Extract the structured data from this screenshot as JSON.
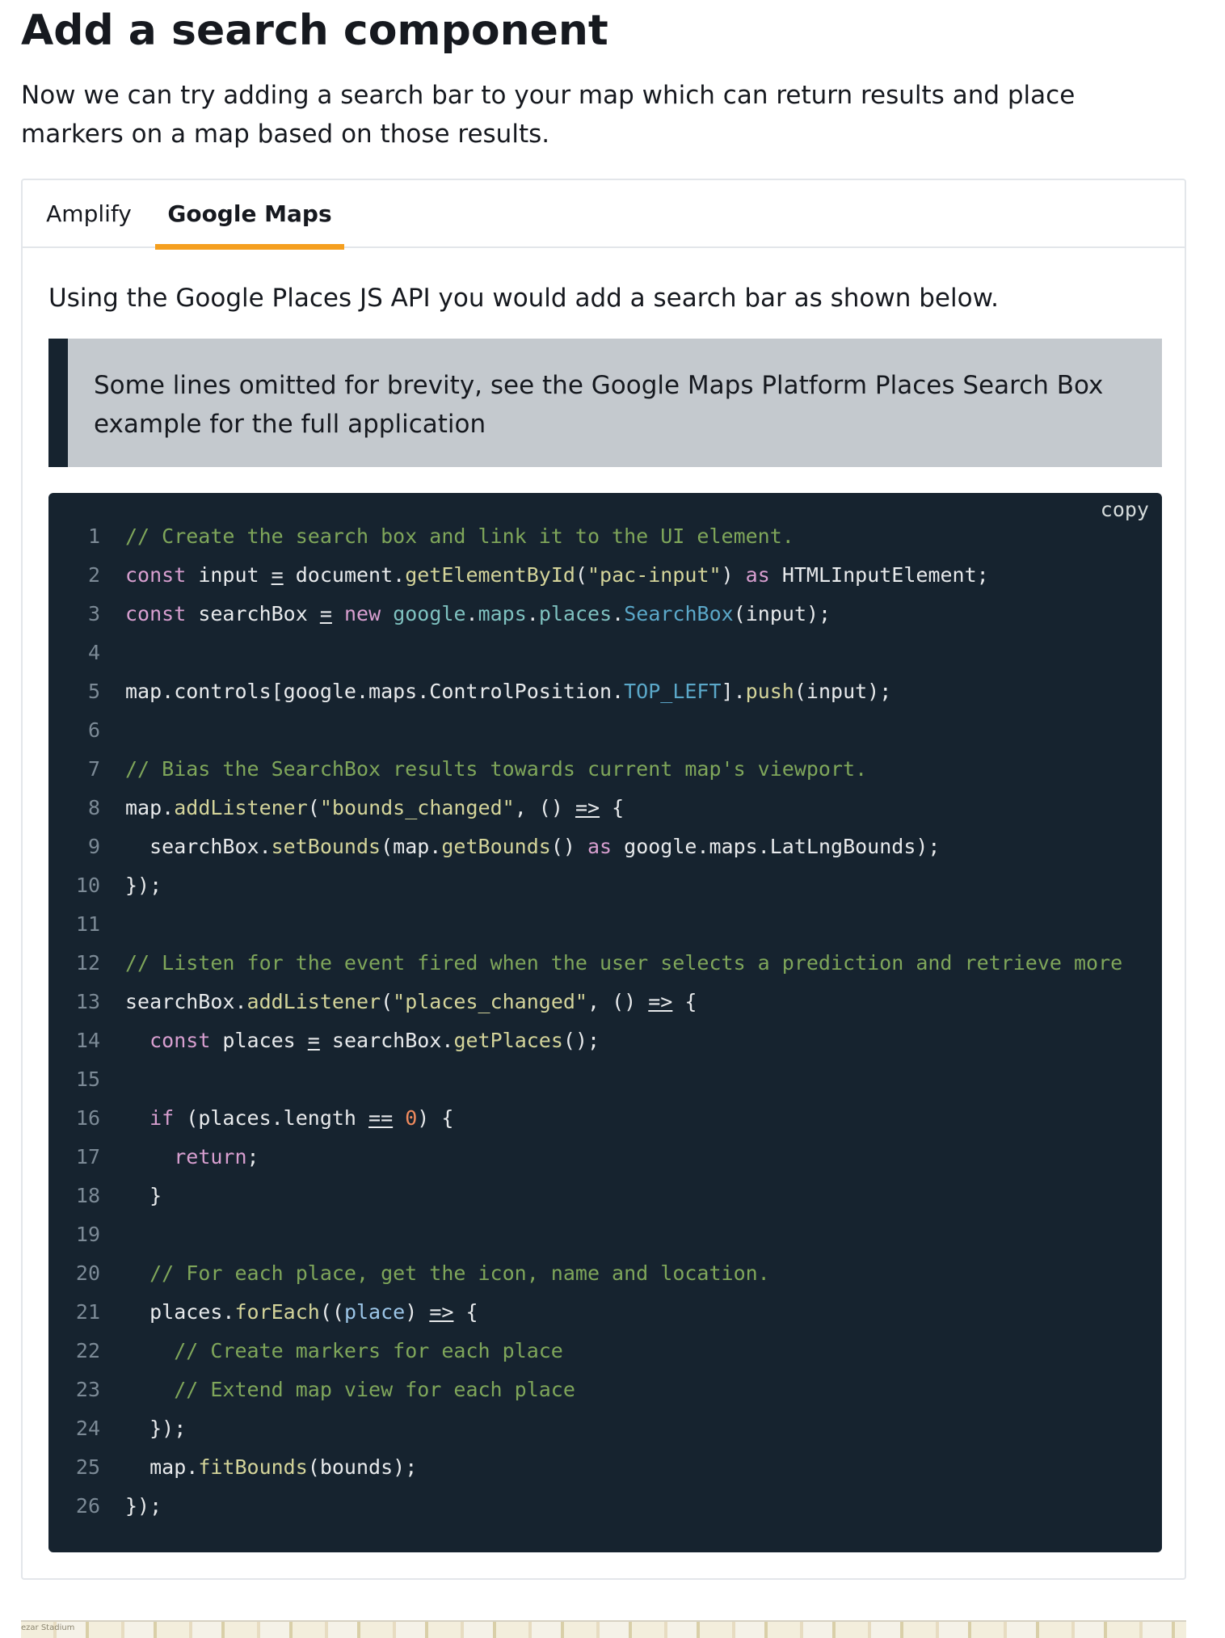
{
  "page": {
    "title": "Add a search component",
    "intro": "Now we can try adding a search bar to your map which can return results and place markers on a map based on those results."
  },
  "tabs": [
    {
      "label": "Amplify",
      "active": false
    },
    {
      "label": "Google Maps",
      "active": true
    }
  ],
  "panel": {
    "text": "Using the Google Places JS API you would add a search bar as shown below.",
    "callout": "Some lines omitted for brevity, see the Google Maps Platform Places Search Box example for the full application"
  },
  "code": {
    "copy_label": "copy",
    "lines": [
      {
        "n": "1",
        "tokens": [
          [
            "comment",
            "// Create the search box and link it to the UI element."
          ]
        ]
      },
      {
        "n": "2",
        "tokens": [
          [
            "keyword",
            "const"
          ],
          [
            "plain",
            " input "
          ],
          [
            "op",
            "="
          ],
          [
            "plain",
            " document."
          ],
          [
            "function",
            "getElementById"
          ],
          [
            "plain",
            "("
          ],
          [
            "string",
            "\"pac-input\""
          ],
          [
            "plain",
            ") "
          ],
          [
            "keyword",
            "as"
          ],
          [
            "plain",
            " HTMLInputElement;"
          ]
        ]
      },
      {
        "n": "3",
        "tokens": [
          [
            "keyword",
            "const"
          ],
          [
            "plain",
            " searchBox "
          ],
          [
            "op",
            "="
          ],
          [
            "plain",
            " "
          ],
          [
            "keyword",
            "new"
          ],
          [
            "plain",
            " "
          ],
          [
            "property",
            "google"
          ],
          [
            "plain",
            "."
          ],
          [
            "property",
            "maps"
          ],
          [
            "plain",
            "."
          ],
          [
            "property",
            "places"
          ],
          [
            "plain",
            "."
          ],
          [
            "class",
            "SearchBox"
          ],
          [
            "plain",
            "(input);"
          ]
        ]
      },
      {
        "n": "4",
        "tokens": []
      },
      {
        "n": "5",
        "tokens": [
          [
            "plain",
            "map.controls[google.maps.ControlPosition."
          ],
          [
            "const",
            "TOP_LEFT"
          ],
          [
            "plain",
            "]."
          ],
          [
            "function",
            "push"
          ],
          [
            "plain",
            "(input);"
          ]
        ]
      },
      {
        "n": "6",
        "tokens": []
      },
      {
        "n": "7",
        "tokens": [
          [
            "comment",
            "// Bias the SearchBox results towards current map's viewport."
          ]
        ]
      },
      {
        "n": "8",
        "tokens": [
          [
            "plain",
            "map."
          ],
          [
            "function",
            "addListener"
          ],
          [
            "plain",
            "("
          ],
          [
            "string",
            "\"bounds_changed\""
          ],
          [
            "plain",
            ", () "
          ],
          [
            "op",
            "=>"
          ],
          [
            "plain",
            " {"
          ]
        ]
      },
      {
        "n": "9",
        "tokens": [
          [
            "plain",
            "  searchBox."
          ],
          [
            "function",
            "setBounds"
          ],
          [
            "plain",
            "(map."
          ],
          [
            "function",
            "getBounds"
          ],
          [
            "plain",
            "() "
          ],
          [
            "keyword",
            "as"
          ],
          [
            "plain",
            " google.maps.LatLngBounds);"
          ]
        ]
      },
      {
        "n": "10",
        "tokens": [
          [
            "plain",
            "});"
          ]
        ]
      },
      {
        "n": "11",
        "tokens": []
      },
      {
        "n": "12",
        "tokens": [
          [
            "comment",
            "// Listen for the event fired when the user selects a prediction and retrieve more"
          ]
        ]
      },
      {
        "n": "13",
        "tokens": [
          [
            "plain",
            "searchBox."
          ],
          [
            "function",
            "addListener"
          ],
          [
            "plain",
            "("
          ],
          [
            "string",
            "\"places_changed\""
          ],
          [
            "plain",
            ", () "
          ],
          [
            "op",
            "=>"
          ],
          [
            "plain",
            " {"
          ]
        ]
      },
      {
        "n": "14",
        "tokens": [
          [
            "plain",
            "  "
          ],
          [
            "keyword",
            "const"
          ],
          [
            "plain",
            " places "
          ],
          [
            "op",
            "="
          ],
          [
            "plain",
            " searchBox."
          ],
          [
            "function",
            "getPlaces"
          ],
          [
            "plain",
            "();"
          ]
        ]
      },
      {
        "n": "15",
        "tokens": []
      },
      {
        "n": "16",
        "tokens": [
          [
            "plain",
            "  "
          ],
          [
            "keyword",
            "if"
          ],
          [
            "plain",
            " (places.length "
          ],
          [
            "op",
            "=="
          ],
          [
            "plain",
            " "
          ],
          [
            "number",
            "0"
          ],
          [
            "plain",
            ") {"
          ]
        ]
      },
      {
        "n": "17",
        "tokens": [
          [
            "plain",
            "    "
          ],
          [
            "keyword",
            "return"
          ],
          [
            "plain",
            ";"
          ]
        ]
      },
      {
        "n": "18",
        "tokens": [
          [
            "plain",
            "  }"
          ]
        ]
      },
      {
        "n": "19",
        "tokens": []
      },
      {
        "n": "20",
        "tokens": [
          [
            "plain",
            "  "
          ],
          [
            "comment",
            "// For each place, get the icon, name and location."
          ]
        ]
      },
      {
        "n": "21",
        "tokens": [
          [
            "plain",
            "  places."
          ],
          [
            "function",
            "forEach"
          ],
          [
            "plain",
            "(("
          ],
          [
            "param",
            "place"
          ],
          [
            "plain",
            ") "
          ],
          [
            "op",
            "=>"
          ],
          [
            "plain",
            " {"
          ]
        ]
      },
      {
        "n": "22",
        "tokens": [
          [
            "plain",
            "    "
          ],
          [
            "comment",
            "// Create markers for each place"
          ]
        ]
      },
      {
        "n": "23",
        "tokens": [
          [
            "plain",
            "    "
          ],
          [
            "comment",
            "// Extend map view for each place"
          ]
        ]
      },
      {
        "n": "24",
        "tokens": [
          [
            "plain",
            "  });"
          ]
        ]
      },
      {
        "n": "25",
        "tokens": [
          [
            "plain",
            "  map."
          ],
          [
            "function",
            "fitBounds"
          ],
          [
            "plain",
            "(bounds);"
          ]
        ]
      },
      {
        "n": "26",
        "tokens": [
          [
            "plain",
            "});"
          ]
        ]
      }
    ]
  },
  "map_preview": {
    "label": "ezar Stadium"
  }
}
